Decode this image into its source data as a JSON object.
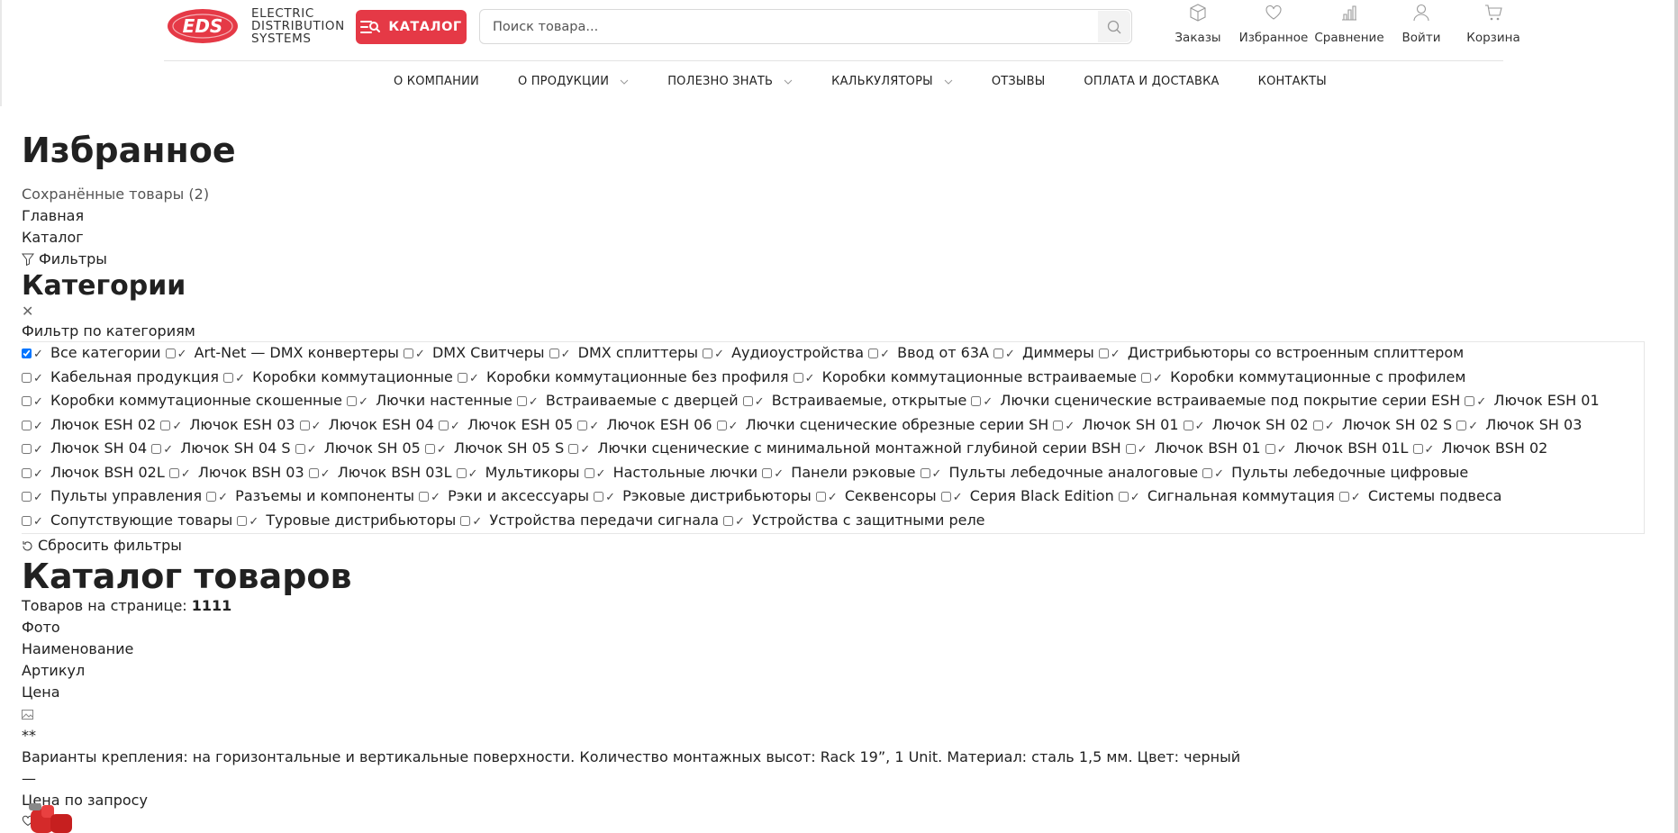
{
  "header": {
    "logo_text": "EDS",
    "brand_lines": [
      "ELECTRIC",
      "DISTRIBUTION",
      "SYSTEMS"
    ],
    "catalog_button": "КАТАЛОГ",
    "search_placeholder": "Поиск товара...",
    "actions": [
      {
        "label": "Заказы",
        "icon": "box-icon"
      },
      {
        "label": "Избранное",
        "icon": "heart-icon"
      },
      {
        "label": "Сравнение",
        "icon": "bar-chart-icon"
      },
      {
        "label": "Войти",
        "icon": "user-icon"
      },
      {
        "label": "Корзина",
        "icon": "cart-icon"
      }
    ]
  },
  "nav": {
    "items": [
      {
        "label": "О КОМПАНИИ",
        "dropdown": false
      },
      {
        "label": "О ПРОДУКЦИИ",
        "dropdown": true
      },
      {
        "label": "ПОЛЕЗНО ЗНАТЬ",
        "dropdown": true
      },
      {
        "label": "КАЛЬКУЛЯТОРЫ",
        "dropdown": true
      },
      {
        "label": "ОТЗЫВЫ",
        "dropdown": false
      },
      {
        "label": "ОПЛАТА И ДОСТАВКА",
        "dropdown": false
      },
      {
        "label": "КОНТАКТЫ",
        "dropdown": false
      }
    ]
  },
  "page": {
    "title": "Избранное",
    "saved": "Сохранённые товары (2)",
    "breadcrumb_home": "Главная",
    "breadcrumb_catalog": "Каталог",
    "filters": "Фильтры",
    "categories_title": "Категории",
    "close": "✕",
    "filter_legend": "Фильтр по категориям",
    "categories": [
      "Все категории",
      "Art-Net — DMX конвертеры",
      "DMX Свитчеры",
      "DMX сплиттеры",
      "Аудиоустройства",
      "Ввод от 63А",
      "Диммеры",
      "Дистрибьюторы со встроенным сплиттером",
      "Кабельная продукция",
      "Коробки коммутационные",
      "Коробки коммутационные без профиля",
      "Коробки коммутационные встраиваемые",
      "Коробки коммутационные с профилем",
      "Коробки коммутационные скошенные",
      "Лючки настенные",
      "Встраиваемые с дверцей",
      "Встраиваемые, открытые",
      "Лючки сценические встраиваемые под покрытие серии ESH",
      "Лючок ESH 01",
      "Лючок ESH 02",
      "Лючок ESH 03",
      "Лючок ESH 04",
      "Лючок ESH 05",
      "Лючок ESH 06",
      "Лючки сценические обрезные серии SH",
      "Лючок SH 01",
      "Лючок SH 02",
      "Лючок SH 02 S",
      "Лючок SH 03",
      "Лючок SH 04",
      "Лючок SH 04 S",
      "Лючок SH 05",
      "Лючок SH 05 S",
      "Лючки сценические с минимальной монтажной глубиной серии BSH",
      "Лючок BSH 01",
      "Лючок BSH 01L",
      "Лючок BSH 02",
      "Лючок BSH 02L",
      "Лючок BSH 03",
      "Лючок BSH 03L",
      "Мультикоры",
      "Настольные лючки",
      "Панели рэковые",
      "Пульты лебедочные аналоговые",
      "Пульты лебедочные цифровые",
      "Пульты управления",
      "Разъемы и компоненты",
      "Рэки и аксессуары",
      "Рэковые дистрибьюторы",
      "Секвенсоры",
      "Серия Black Edition",
      "Сигнальная коммутация",
      "Системы подвеса",
      "Сопутствующие товары",
      "Туровые дистрибьюторы",
      "Устройства передачи сигнала",
      "Устройства с защитными реле"
    ],
    "checked_index": 0,
    "reset": "Сбросить фильтры",
    "catalog_title": "Каталог товаров",
    "per_page_label": "Товаров на странице: ",
    "per_page_value": "1111",
    "columns": [
      "Фото",
      "Наименование",
      "Артикул",
      "Цена"
    ],
    "stars": "**",
    "description": "Варианты крепления: на горизонтальные и вертикальные поверхности. Количество монтажных высот: Rack 19”, 1 Unit. Материал: сталь 1,5 мм. Цвет: черный",
    "dash": "—",
    "price": "Цена по запросу"
  },
  "colors": {
    "accent": "#e53946",
    "text": "#212121"
  }
}
